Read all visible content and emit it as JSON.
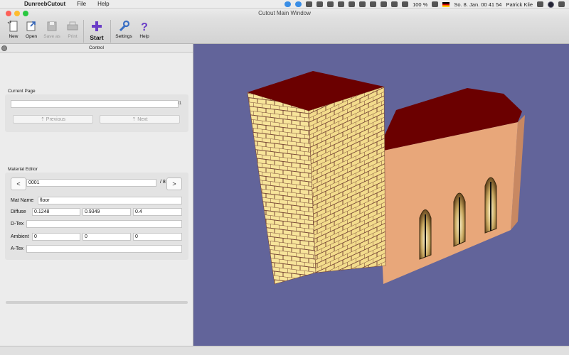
{
  "menubar": {
    "app_name": "DunreebCutout",
    "items": [
      "File",
      "Help"
    ],
    "battery": "100 %",
    "datetime": "So. 8. Jan.  00 41 54",
    "user": "Patrick Klie"
  },
  "window": {
    "title": "Cutout Main Window"
  },
  "toolbar": {
    "new_label": "New",
    "open_label": "Open",
    "save_as_label": "Save as",
    "print_label": "Print",
    "start_label": "Start",
    "settings_label": "Settings",
    "help_label": "Help"
  },
  "panel": {
    "title": "Control",
    "current_page": {
      "label": "Current Page",
      "value": "",
      "total": "/1",
      "previous_label": "Previous",
      "next_label": "Next"
    },
    "material_editor": {
      "label": "Material Editor",
      "prev_label": "<",
      "next_label": ">",
      "index": "0001",
      "total": "/ 8",
      "mat_name_label": "Mat Name",
      "mat_name": "floor",
      "diffuse_label": "Diffuse",
      "diffuse": [
        "0.1248",
        "0.9349",
        "0.4"
      ],
      "dtex_label": "D-Tex",
      "dtex": "",
      "ambient_label": "Ambient",
      "ambient": [
        "0",
        "0",
        "0"
      ],
      "atex_label": "A-Tex",
      "atex": ""
    }
  },
  "viewport": {
    "background": "#62649a",
    "roof_color": "#6b0000",
    "brick_color": "#f7e49a",
    "mortar_color": "#7a4a38",
    "wall_color": "#e8a77a"
  }
}
